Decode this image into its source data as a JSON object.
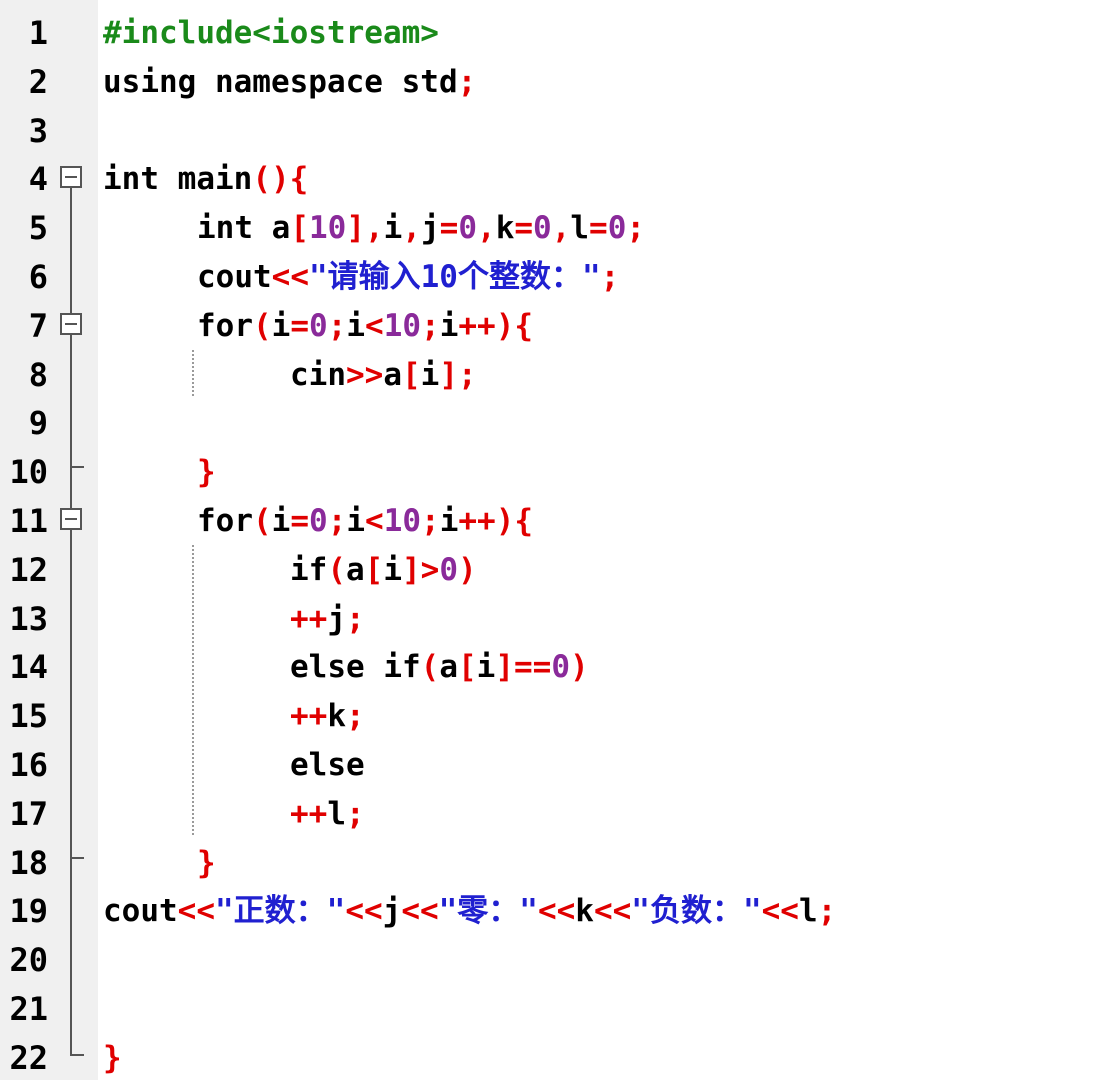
{
  "colors": {
    "default": "#000000",
    "preprocessor": "#1a8a1a",
    "operator": "#e00000",
    "number": "#8a2a9a",
    "string": "#2020d0"
  },
  "editor": {
    "lines": [
      {
        "number": "1",
        "indent": 0,
        "tokens": [
          {
            "text": "#include<iostream>",
            "kind": "preprocessor"
          }
        ]
      },
      {
        "number": "2",
        "indent": 0,
        "tokens": [
          {
            "text": "using namespace std",
            "kind": "default"
          },
          {
            "text": ";",
            "kind": "operator"
          }
        ]
      },
      {
        "number": "3",
        "indent": 0,
        "tokens": []
      },
      {
        "number": "4",
        "indent": 0,
        "tokens": [
          {
            "text": "int main",
            "kind": "default"
          },
          {
            "text": "(){",
            "kind": "operator"
          }
        ]
      },
      {
        "number": "5",
        "indent": 1,
        "tokens": [
          {
            "text": "int a",
            "kind": "default"
          },
          {
            "text": "[",
            "kind": "operator"
          },
          {
            "text": "10",
            "kind": "number"
          },
          {
            "text": "],",
            "kind": "operator"
          },
          {
            "text": "i",
            "kind": "default"
          },
          {
            "text": ",",
            "kind": "operator"
          },
          {
            "text": "j",
            "kind": "default"
          },
          {
            "text": "=",
            "kind": "operator"
          },
          {
            "text": "0",
            "kind": "number"
          },
          {
            "text": ",",
            "kind": "operator"
          },
          {
            "text": "k",
            "kind": "default"
          },
          {
            "text": "=",
            "kind": "operator"
          },
          {
            "text": "0",
            "kind": "number"
          },
          {
            "text": ",",
            "kind": "operator"
          },
          {
            "text": "l",
            "kind": "default"
          },
          {
            "text": "=",
            "kind": "operator"
          },
          {
            "text": "0",
            "kind": "number"
          },
          {
            "text": ";",
            "kind": "operator"
          }
        ]
      },
      {
        "number": "6",
        "indent": 1,
        "tokens": [
          {
            "text": "cout",
            "kind": "default"
          },
          {
            "text": "<<",
            "kind": "operator"
          },
          {
            "text": "\"请输入10个整数：\"",
            "kind": "string"
          },
          {
            "text": ";",
            "kind": "operator"
          }
        ]
      },
      {
        "number": "7",
        "indent": 1,
        "tokens": [
          {
            "text": "for",
            "kind": "default"
          },
          {
            "text": "(",
            "kind": "operator"
          },
          {
            "text": "i",
            "kind": "default"
          },
          {
            "text": "=",
            "kind": "operator"
          },
          {
            "text": "0",
            "kind": "number"
          },
          {
            "text": ";",
            "kind": "operator"
          },
          {
            "text": "i",
            "kind": "default"
          },
          {
            "text": "<",
            "kind": "operator"
          },
          {
            "text": "10",
            "kind": "number"
          },
          {
            "text": ";",
            "kind": "operator"
          },
          {
            "text": "i",
            "kind": "default"
          },
          {
            "text": "++){",
            "kind": "operator"
          }
        ]
      },
      {
        "number": "8",
        "indent": 2,
        "tokens": [
          {
            "text": "cin",
            "kind": "default"
          },
          {
            "text": ">>",
            "kind": "operator"
          },
          {
            "text": "a",
            "kind": "default"
          },
          {
            "text": "[",
            "kind": "operator"
          },
          {
            "text": "i",
            "kind": "default"
          },
          {
            "text": "];",
            "kind": "operator"
          }
        ]
      },
      {
        "number": "9",
        "indent": 0,
        "tokens": []
      },
      {
        "number": "10",
        "indent": 1,
        "tokens": [
          {
            "text": "}",
            "kind": "operator"
          }
        ]
      },
      {
        "number": "11",
        "indent": 1,
        "tokens": [
          {
            "text": "for",
            "kind": "default"
          },
          {
            "text": "(",
            "kind": "operator"
          },
          {
            "text": "i",
            "kind": "default"
          },
          {
            "text": "=",
            "kind": "operator"
          },
          {
            "text": "0",
            "kind": "number"
          },
          {
            "text": ";",
            "kind": "operator"
          },
          {
            "text": "i",
            "kind": "default"
          },
          {
            "text": "<",
            "kind": "operator"
          },
          {
            "text": "10",
            "kind": "number"
          },
          {
            "text": ";",
            "kind": "operator"
          },
          {
            "text": "i",
            "kind": "default"
          },
          {
            "text": "++){",
            "kind": "operator"
          }
        ]
      },
      {
        "number": "12",
        "indent": 2,
        "tokens": [
          {
            "text": "if",
            "kind": "default"
          },
          {
            "text": "(",
            "kind": "operator"
          },
          {
            "text": "a",
            "kind": "default"
          },
          {
            "text": "[",
            "kind": "operator"
          },
          {
            "text": "i",
            "kind": "default"
          },
          {
            "text": "]>",
            "kind": "operator"
          },
          {
            "text": "0",
            "kind": "number"
          },
          {
            "text": ")",
            "kind": "operator"
          }
        ]
      },
      {
        "number": "13",
        "indent": 2,
        "tokens": [
          {
            "text": "++",
            "kind": "operator"
          },
          {
            "text": "j",
            "kind": "default"
          },
          {
            "text": ";",
            "kind": "operator"
          }
        ]
      },
      {
        "number": "14",
        "indent": 2,
        "tokens": [
          {
            "text": "else if",
            "kind": "default"
          },
          {
            "text": "(",
            "kind": "operator"
          },
          {
            "text": "a",
            "kind": "default"
          },
          {
            "text": "[",
            "kind": "operator"
          },
          {
            "text": "i",
            "kind": "default"
          },
          {
            "text": "]==",
            "kind": "operator"
          },
          {
            "text": "0",
            "kind": "number"
          },
          {
            "text": ")",
            "kind": "operator"
          }
        ]
      },
      {
        "number": "15",
        "indent": 2,
        "tokens": [
          {
            "text": "++",
            "kind": "operator"
          },
          {
            "text": "k",
            "kind": "default"
          },
          {
            "text": ";",
            "kind": "operator"
          }
        ]
      },
      {
        "number": "16",
        "indent": 2,
        "tokens": [
          {
            "text": "else",
            "kind": "default"
          }
        ]
      },
      {
        "number": "17",
        "indent": 2,
        "tokens": [
          {
            "text": "++",
            "kind": "operator"
          },
          {
            "text": "l",
            "kind": "default"
          },
          {
            "text": ";",
            "kind": "operator"
          }
        ]
      },
      {
        "number": "18",
        "indent": 1,
        "tokens": [
          {
            "text": "}",
            "kind": "operator"
          }
        ]
      },
      {
        "number": "19",
        "indent": 0,
        "tokens": [
          {
            "text": "cout",
            "kind": "default"
          },
          {
            "text": "<<",
            "kind": "operator"
          },
          {
            "text": "\"正数：\"",
            "kind": "string"
          },
          {
            "text": "<<",
            "kind": "operator"
          },
          {
            "text": "j",
            "kind": "default"
          },
          {
            "text": "<<",
            "kind": "operator"
          },
          {
            "text": "\"零：\"",
            "kind": "string"
          },
          {
            "text": "<<",
            "kind": "operator"
          },
          {
            "text": "k",
            "kind": "default"
          },
          {
            "text": "<<",
            "kind": "operator"
          },
          {
            "text": "\"负数：\"",
            "kind": "string"
          },
          {
            "text": "<<",
            "kind": "operator"
          },
          {
            "text": "l",
            "kind": "default"
          },
          {
            "text": ";",
            "kind": "operator"
          }
        ]
      },
      {
        "number": "20",
        "indent": 0,
        "tokens": []
      },
      {
        "number": "21",
        "indent": 0,
        "tokens": []
      },
      {
        "number": "22",
        "indent": 0,
        "tokens": [
          {
            "text": "}",
            "kind": "operator"
          }
        ]
      }
    ]
  }
}
